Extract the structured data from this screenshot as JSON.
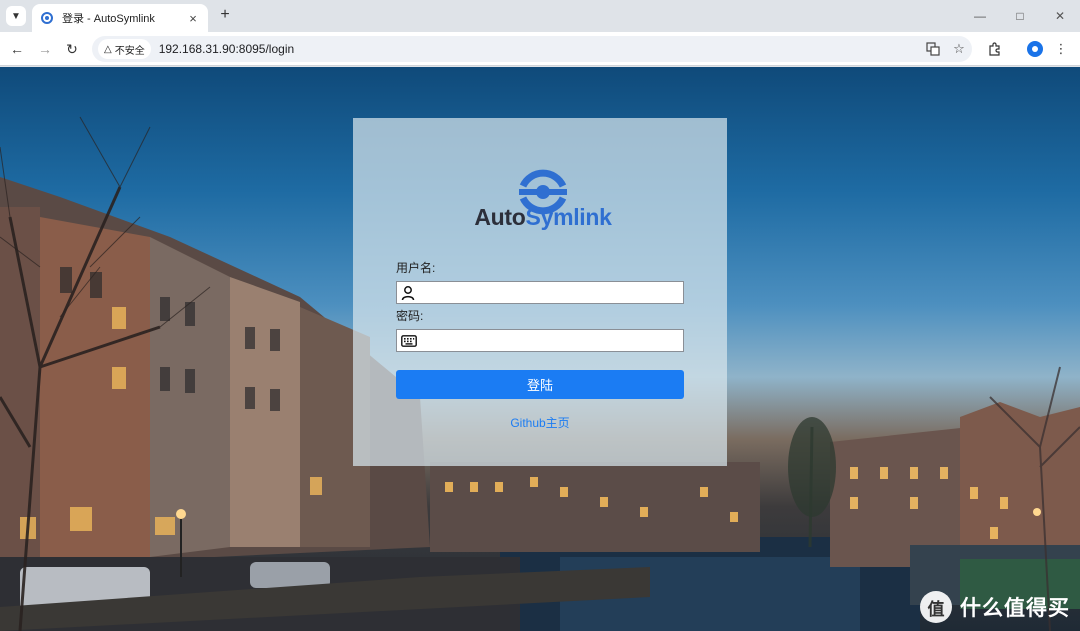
{
  "browser": {
    "tab_title": "登录 - AutoSymlink",
    "new_tab": "+",
    "security_label": "不安全",
    "url": "192.168.31.90:8095/login"
  },
  "login": {
    "logo_part1": "Auto",
    "logo_part2": "Symlink",
    "username_label": "用户名:",
    "password_label": "密码:",
    "username_value": "",
    "password_value": "",
    "login_button": "登陆",
    "github_link": "Github主页"
  },
  "watermark": {
    "badge": "值",
    "text": "什么值得买"
  },
  "colors": {
    "accent": "#1b7cf3",
    "logo_blue": "#2f6fd1",
    "logo_dark": "#2c2f3a"
  }
}
